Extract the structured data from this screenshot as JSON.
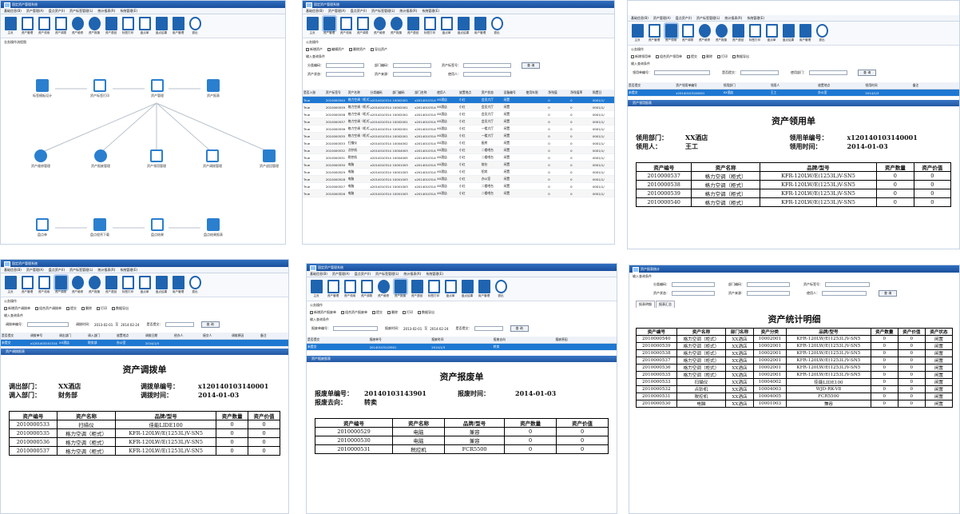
{
  "app_title": "固定资产管理系统",
  "menu": [
    "基础信息(B)",
    "资产管理(A)",
    "盘点资产(I)",
    "资产标签管理(L)",
    "统计报表(R)",
    "系统管理(E)"
  ],
  "toolbar": [
    "主页",
    "资产管理",
    "资产领用",
    "资产调拨",
    "资产维修",
    "资产报废",
    "资产退回",
    "标签打印",
    "盘点单",
    "盘点结果",
    "用户管理",
    "退出"
  ],
  "toolbar_icons": [
    "home-icon",
    "asset-icon",
    "receive-icon",
    "transfer-icon",
    "repair-icon",
    "scrap-icon",
    "return-icon",
    "label-icon",
    "stock-sheet-icon",
    "stock-result-icon",
    "users-icon",
    "exit-icon"
  ],
  "accent": "#1f64b0",
  "p1": {
    "section": "业务操作流程图",
    "row1": [
      "标签模板设计",
      "资产标签打印",
      "资产管理",
      "资产报表"
    ],
    "row2": [
      "资产维修管理",
      "资产报废管理",
      "资产领用管理",
      "资产调拨管理",
      "资产退回管理"
    ],
    "row3": [
      "盘点单",
      "盘点程序下载",
      "盘点结果",
      "盘点结果报表"
    ]
  },
  "p2": {
    "ops_title": "公务操作",
    "ops": [
      "新增资产",
      "编辑资产",
      "删除资产",
      "导出资产"
    ],
    "query_title": "输入查询条件",
    "q1": [
      "分类编码：",
      "部门编码：",
      "资产标签号："
    ],
    "q2": [
      "资产状态：",
      "资产来源：",
      "使用人："
    ],
    "query_btn": "查 询",
    "headers": [
      "是否入账",
      "资产标签号",
      "资产名称",
      "分类编码",
      "部门编码",
      "部门名称",
      "使用人",
      "放置地点",
      "资产状态",
      "设备编号",
      "使用年限",
      "净残值",
      "净残值率",
      "购置日"
    ],
    "rows": [
      [
        "True",
        "2010000540",
        "格力空调（柜式）",
        "x20140103140001",
        "10002001",
        "x20140103140001",
        "XX酒店",
        "小红",
        "会员大厅",
        "闲置",
        "",
        "0",
        "0",
        "0001/1/"
      ],
      [
        "True",
        "2010000539",
        "格力空调（柜式）",
        "x20140103140001",
        "10002001",
        "x20140103140001",
        "XX酒店",
        "小红",
        "会员大厅",
        "闲置",
        "",
        "0",
        "0",
        "0001/1/"
      ],
      [
        "True",
        "2010000538",
        "格力空调（柜式）",
        "x20140103140001",
        "10002001",
        "x20140103140001",
        "XX酒店",
        "小红",
        "会员大厅",
        "闲置",
        "",
        "0",
        "0",
        "0001/1/"
      ],
      [
        "True",
        "2010000537",
        "格力空调（柜式）",
        "x20140103140001",
        "10002001",
        "x20140103140001",
        "XX酒店",
        "小红",
        "会员大厅",
        "闲置",
        "",
        "0",
        "0",
        "0001/1/"
      ],
      [
        "True",
        "2010000536",
        "格力空调（柜式）",
        "x20140103140001",
        "10002001",
        "x20140103140001",
        "XX酒店",
        "小红",
        "一楼大厅",
        "闲置",
        "",
        "0",
        "0",
        "0001/1/"
      ],
      [
        "True",
        "2010000535",
        "格力空调（柜式）",
        "x20140103140001",
        "10002001",
        "x20140103140001",
        "XX酒店",
        "小红",
        "一楼大厅",
        "闲置",
        "",
        "0",
        "0",
        "0001/1/"
      ],
      [
        "True",
        "2010000533",
        "扫描仪",
        "x20140103140001",
        "10004002",
        "x20140103140001",
        "XX酒店",
        "小红",
        "厨房",
        "闲置",
        "",
        "0",
        "0",
        "0001/1/"
      ],
      [
        "True",
        "2010000532",
        "点钞机",
        "x20140103140001",
        "10004003",
        "x20140103140001",
        "XX酒店",
        "小红",
        "二楼吧台",
        "闲置",
        "",
        "0",
        "0",
        "0001/1/"
      ],
      [
        "True",
        "2010000531",
        "税控机",
        "x20140103140001",
        "10004005",
        "x20140103140001",
        "XX酒店",
        "小红",
        "二楼吧台",
        "闲置",
        "",
        "0",
        "0",
        "0001/1/"
      ],
      [
        "True",
        "2010000530",
        "电脑",
        "x20140103140001",
        "10001003",
        "x20140103140001",
        "XX酒店",
        "小红",
        "前台",
        "闲置",
        "",
        "0",
        "0",
        "0001/1/"
      ],
      [
        "True",
        "2010000529",
        "电脑",
        "x20140103140001",
        "10001003",
        "x20140103140001",
        "XX酒店",
        "小红",
        "招宾",
        "闲置",
        "",
        "0",
        "0",
        "0001/1/"
      ],
      [
        "True",
        "2010000528",
        "电脑",
        "x20140103140001",
        "10001003",
        "x20140103140001",
        "XX酒店",
        "小红",
        "办公室",
        "闲置",
        "",
        "0",
        "0",
        "0001/1/"
      ],
      [
        "True",
        "2010000527",
        "电脑",
        "x20140103140001",
        "10001003",
        "x20140103140001",
        "XX酒店",
        "小红",
        "二楼吧台",
        "闲置",
        "",
        "0",
        "0",
        "0001/1/"
      ],
      [
        "True",
        "2010000526",
        "电脑",
        "x20140103140001",
        "10001003",
        "x20140103140001",
        "XX酒店",
        "小红",
        "二楼吧台",
        "闲置",
        "",
        "0",
        "0",
        "0001/1/"
      ]
    ]
  },
  "p3": {
    "ops": [
      "新增领用单",
      "组合资产领用单",
      "提交",
      "删除",
      "打印",
      "数据导出"
    ],
    "q": [
      "领用单编号：",
      "是否提交：",
      "使用部门："
    ],
    "query_btn": "查 询",
    "headers": [
      "是否提交",
      "资产领用单编号",
      "领用部门",
      "领用人",
      "放置地点",
      "领用时间",
      "备注"
    ],
    "row": [
      "未提交",
      "x20140103140001",
      "XX酒店",
      "王工",
      "办公室",
      "2014/1/3",
      ""
    ],
    "sub_title": "资产领用报表",
    "report": {
      "title": "资产领用单",
      "l1k": "领用部门：",
      "l1v": "XX酒店",
      "l2k": "领用人：",
      "l2v": "王工",
      "r1k": "领用单编号：",
      "r1v": "x120140103140001",
      "r2k": "领用时间：",
      "r2v": "2014-01-03",
      "headers": [
        "资产编号",
        "资产名称",
        "品牌/型号",
        "资产数量",
        "资产价值"
      ],
      "rows": [
        [
          "2010000537",
          "格力空调（柜式）",
          "KFR-120LW/E(1253L)V-SN5",
          "0",
          "0"
        ],
        [
          "2010000538",
          "格力空调（柜式）",
          "KFR-120LW/E(1253L)V-SN5",
          "0",
          "0"
        ],
        [
          "2010000539",
          "格力空调（柜式）",
          "KFR-120LW/E(1253L)V-SN5",
          "0",
          "0"
        ],
        [
          "2010000540",
          "格力空调（柜式）",
          "KFR-120LW/E(1253L)V-SN5",
          "0",
          "0"
        ]
      ]
    }
  },
  "p4": {
    "ops": [
      "新增资产调拨单",
      "组合资产调拨单",
      "提交",
      "删除",
      "打印",
      "数据导出"
    ],
    "q1": "调拨单编号：",
    "q2": "调拨时间：",
    "d1": "2013-02-01",
    "d_sep": "至",
    "d2": "2014-02-24",
    "q3": "是否提交：",
    "query_btn": "查 询",
    "headers": [
      "是否提交",
      "调拨单号",
      "调出部门",
      "调入部门",
      "放置地点",
      "调拨日期",
      "经办人",
      "接交人",
      "调拨原因",
      "备注"
    ],
    "row": [
      "未提交",
      "x1201403101314",
      "XX酒店",
      "财务部",
      "办公室",
      "2014/1/3",
      "",
      "",
      "",
      ""
    ],
    "sub_title": "资产调拨报表",
    "report": {
      "title": "资产调拨单",
      "l1k": "调出部门：",
      "l1v": "XX酒店",
      "l2k": "调入部门：",
      "l2v": "财务部",
      "r1k": "调拨单编号：",
      "r1v": "x120140103140001",
      "r2k": "调拨时间：",
      "r2v": "2014-01-03",
      "headers": [
        "资产编号",
        "资产名称",
        "品牌/型号",
        "资产数量",
        "资产价值"
      ],
      "rows": [
        [
          "2010000533",
          "扫描仪",
          "佳能LIDE100",
          "0",
          "0"
        ],
        [
          "2010000535",
          "格力空调（柜式）",
          "KFR-120LW/E(1253L)V-SN5",
          "0",
          "0"
        ],
        [
          "2010000536",
          "格力空调（柜式）",
          "KFR-120LW/E(1253L)V-SN5",
          "0",
          "0"
        ],
        [
          "2010000537",
          "格力空调（柜式）",
          "KFR-120LW/E(1253L)V-SN5",
          "0",
          "0"
        ]
      ]
    }
  },
  "p5": {
    "ops": [
      "新增资产报废单",
      "组合资产报废单",
      "提交",
      "删除",
      "打印",
      "数据导出"
    ],
    "q1": "报废单编号：",
    "q2": "报废时间：",
    "d1": "2013-02-01",
    "d_sep": "至",
    "d2": "2014-02-24",
    "q3": "是否提交：",
    "query_btn": "查 询",
    "headers": [
      "是否提交",
      "报废单号",
      "报废时间",
      "报废去向",
      "报废原因"
    ],
    "row": [
      "未提交",
      "20140103143901",
      "2014/1/3",
      "转卖",
      ""
    ],
    "sub_title": "资产报废报表",
    "report": {
      "title": "资产报废单",
      "l1k": "报废单编号：",
      "l1v": "20140103143901",
      "l2k": "报废去向：",
      "l2v": "转卖",
      "r1k": "报废时间：",
      "r1v": "2014-01-03",
      "headers": [
        "资产编号",
        "资产名称",
        "品牌/型号",
        "资产数量",
        "资产价值"
      ],
      "rows": [
        [
          "2010000529",
          "电脑",
          "兼容",
          "0",
          "0"
        ],
        [
          "2010000530",
          "电脑",
          "兼容",
          "0",
          "0"
        ],
        [
          "2010000531",
          "税控机",
          "FCR5500",
          "0",
          "0"
        ]
      ]
    }
  },
  "p6": {
    "title": "资产报表统计",
    "query_title": "输入查询条件",
    "q1": [
      "分类编码：",
      "部门编码：",
      "资产标签号："
    ],
    "q2": [
      "资产状态：",
      "资产来源：",
      "使用人："
    ],
    "query_btn": "查 询",
    "tabs": [
      "报表明细",
      "报表汇总"
    ],
    "report": {
      "title": "资产统计明细",
      "headers": [
        "资产编号",
        "资产名称",
        "部门名称",
        "资产分类",
        "品牌/型号",
        "资产数量",
        "资产价值",
        "资产状态"
      ],
      "rows": [
        [
          "2010000540",
          "格力空调（柜式）",
          "XX酒店",
          "10002001",
          "KFR-120LW/E(1253L)V-SN5",
          "0",
          "0",
          "闲置"
        ],
        [
          "2010000539",
          "格力空调（柜式）",
          "XX酒店",
          "10002001",
          "KFR-120LW/E(1253L)V-SN5",
          "0",
          "0",
          "闲置"
        ],
        [
          "2010000538",
          "格力空调（柜式）",
          "XX酒店",
          "10002001",
          "KFR-120LW/E(1253L)V-SN5",
          "0",
          "0",
          "闲置"
        ],
        [
          "2010000537",
          "格力空调（柜式）",
          "XX酒店",
          "10002001",
          "KFR-120LW/E(1253L)V-SN5",
          "0",
          "0",
          "闲置"
        ],
        [
          "2010000536",
          "格力空调（柜式）",
          "XX酒店",
          "10002001",
          "KFR-120LW/E(1253L)V-SN5",
          "0",
          "0",
          "闲置"
        ],
        [
          "2010000535",
          "格力空调（柜式）",
          "XX酒店",
          "10002001",
          "KFR-120LW/E(1253L)V-SN5",
          "0",
          "0",
          "闲置"
        ],
        [
          "2010000533",
          "扫描仪",
          "XX酒店",
          "10004002",
          "佳能LIDE100",
          "0",
          "0",
          "闲置"
        ],
        [
          "2010000532",
          "点钞机",
          "XX酒店",
          "10004003",
          "WJD-RK-V8",
          "0",
          "0",
          "闲置"
        ],
        [
          "2010000531",
          "税控机",
          "XX酒店",
          "10004005",
          "FCR5500",
          "0",
          "0",
          "闲置"
        ],
        [
          "2010000530",
          "电脑",
          "XX酒店",
          "10001003",
          "兼容",
          "0",
          "0",
          "闲置"
        ]
      ]
    }
  }
}
